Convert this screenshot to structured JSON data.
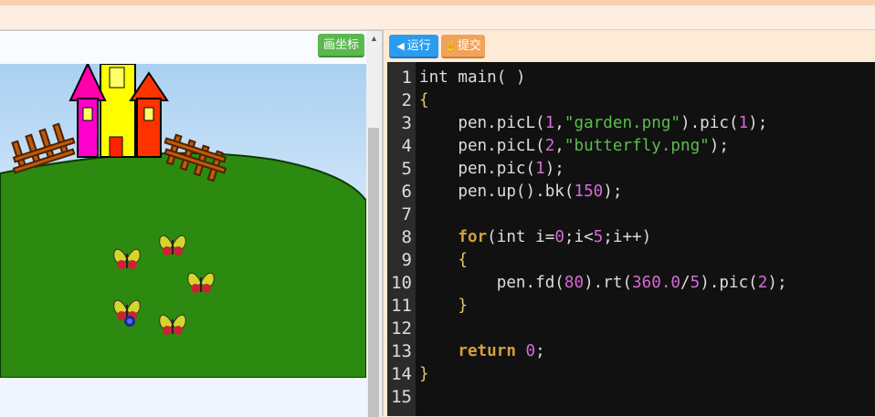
{
  "canvas": {
    "draw_button": "画坐标"
  },
  "editor": {
    "run_button": "运行",
    "submit_button": "提交",
    "line_numbers": [
      "1",
      "2",
      "3",
      "4",
      "5",
      "6",
      "7",
      "8",
      "9",
      "10",
      "11",
      "12",
      "13",
      "14",
      "15"
    ],
    "code": {
      "l1": "int main( )",
      "l2": "{",
      "l3": {
        "a": "    pen.picL(",
        "n1": "1",
        "b": ",",
        "s": "\"garden.png\"",
        "c": ").pic(",
        "n2": "1",
        "d": ");"
      },
      "l4": {
        "a": "    pen.picL(",
        "n1": "2",
        "b": ",",
        "s": "\"butterfly.png\"",
        "c": ");"
      },
      "l5": {
        "a": "    pen.pic(",
        "n1": "1",
        "b": ");"
      },
      "l6": {
        "a": "    pen.up().bk(",
        "n1": "150",
        "b": ");"
      },
      "l8": {
        "kw": "for",
        "a": "(int i=",
        "n1": "0",
        "b": ";i<",
        "n2": "5",
        "c": ";i++)"
      },
      "l9": "{",
      "l10": {
        "a": "        pen.fd(",
        "n1": "80",
        "b": ").rt(",
        "n2": "360.0",
        "c": "/",
        "n3": "5",
        "d": ").pic(",
        "n4": "2",
        "e": ");"
      },
      "l11": "}",
      "l13": {
        "kw": "return",
        "n1": "0",
        "b": ";"
      },
      "l14": "}"
    }
  },
  "colors": {
    "run": "#2a9cf0",
    "submit": "#f0a35a",
    "draw": "#5bb84f",
    "editor_bg": "#111111"
  }
}
